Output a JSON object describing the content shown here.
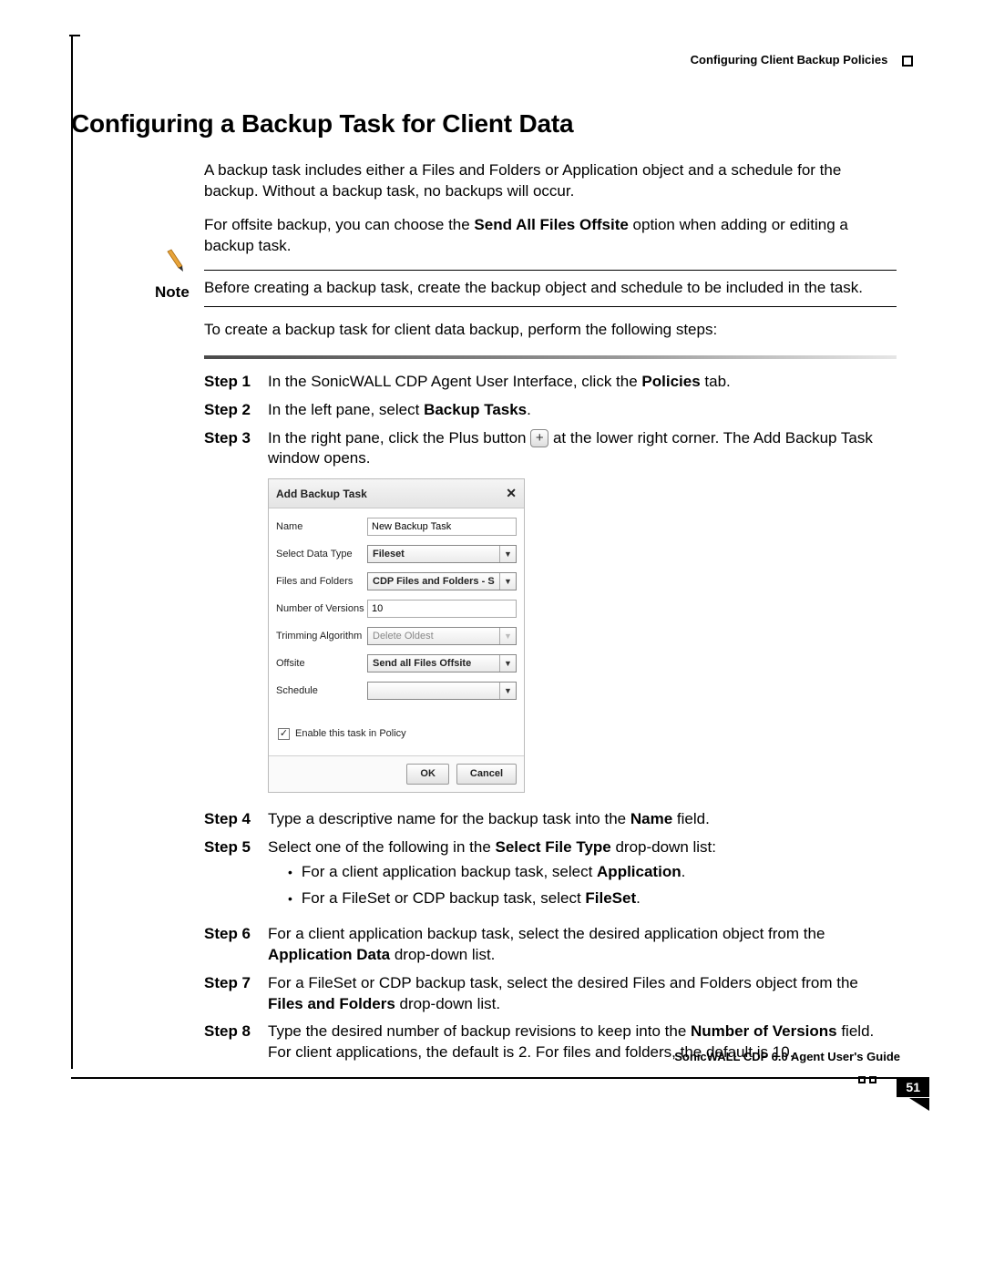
{
  "header": {
    "section_title": "Configuring Client Backup Policies"
  },
  "title": "Configuring a Backup Task for Client Data",
  "intro": {
    "p1": "A backup task includes either a Files and Folders or Application object and a schedule for the backup. Without a backup task, no backups will occur.",
    "p2a": "For offsite backup, you can choose the ",
    "p2b": "Send All Files Offsite",
    "p2c": " option when adding or editing a backup task."
  },
  "note": {
    "label": "Note",
    "text": "Before creating a backup task, create the backup object and schedule to be included in the task."
  },
  "lead": "To create a backup task for client data backup, perform the following steps:",
  "steps": {
    "s1": {
      "label": "Step 1",
      "a": "In the SonicWALL CDP Agent User Interface, click the ",
      "b": "Policies",
      "c": " tab."
    },
    "s2": {
      "label": "Step 2",
      "a": "In the left pane, select ",
      "b": "Backup Tasks",
      "c": "."
    },
    "s3": {
      "label": "Step 3",
      "a": "In the right pane, click the Plus button ",
      "b": " at the lower right corner. The Add Backup Task window opens."
    },
    "s4": {
      "label": "Step 4",
      "a": "Type a descriptive name for the backup task into the ",
      "b": "Name",
      "c": " field."
    },
    "s5": {
      "label": "Step 5",
      "a": "Select one of the following in the ",
      "b": "Select File Type",
      "c": " drop-down list:",
      "li1a": "For a client application backup task, select ",
      "li1b": "Application",
      "li1c": ".",
      "li2a": "For a FileSet or CDP backup task, select ",
      "li2b": "FileSet",
      "li2c": "."
    },
    "s6": {
      "label": "Step 6",
      "a": "For a client application backup task, select the desired application object from the ",
      "b": "Application Data",
      "c": " drop-down list."
    },
    "s7": {
      "label": "Step 7",
      "a": "For a FileSet or CDP backup task, select the desired Files and Folders object from the ",
      "b": "Files and Folders",
      "c": " drop-down list."
    },
    "s8": {
      "label": "Step 8",
      "a": "Type the desired number of backup revisions to keep into the ",
      "b": "Number of Versions",
      "c": " field. For client applications, the default is 2. For files and folders, the default is 10."
    }
  },
  "dialog": {
    "title": "Add Backup Task",
    "close": "✕",
    "rows": {
      "name": {
        "label": "Name",
        "value": "New Backup Task"
      },
      "dtype": {
        "label": "Select Data Type",
        "value": "Fileset"
      },
      "ff": {
        "label": "Files and Folders",
        "value": "CDP Files and Folders - S"
      },
      "ver": {
        "label": "Number of Versions",
        "value": "10"
      },
      "trim": {
        "label": "Trimming Algorithm",
        "value": "Delete Oldest"
      },
      "off": {
        "label": "Offsite",
        "value": "Send all Files Offsite"
      },
      "sched": {
        "label": "Schedule",
        "value": ""
      }
    },
    "checkbox": {
      "checked": "✓",
      "label": "Enable this task in Policy"
    },
    "ok": "OK",
    "cancel": "Cancel"
  },
  "footer": {
    "guide": "SonicWALL CDP 6.0 Agent User's Guide",
    "page": "51"
  }
}
